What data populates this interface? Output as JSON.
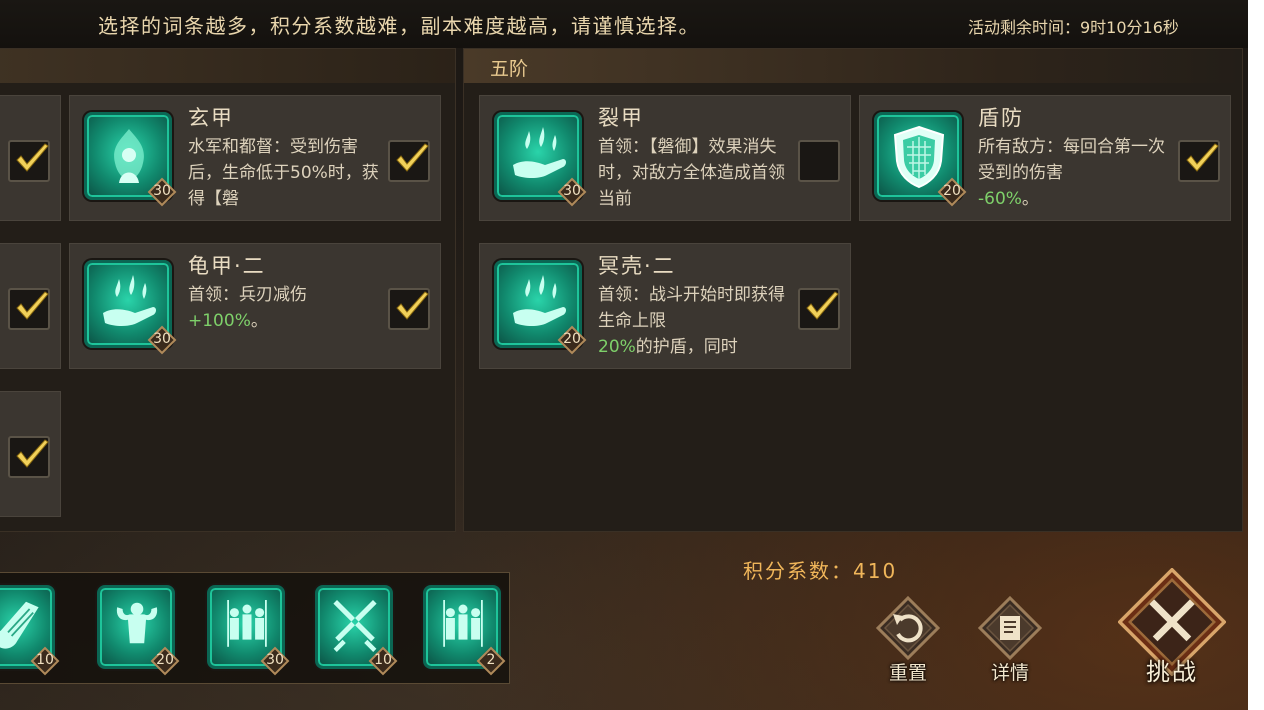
{
  "notice": "选择的词条越多，积分系数越难，副本难度越高，请谨慎选择。",
  "timer": "活动剩余时间：9时10分16秒",
  "right_panel": {
    "title": "五阶"
  },
  "cards": {
    "left_col1": [
      {
        "checked": true
      },
      {
        "checked": true
      },
      {
        "checked": true
      }
    ],
    "xuanjia": {
      "title": "玄甲",
      "desc": "水军和都督：受到伤害后，生命低于50%时，获得【磐",
      "icon": "flame-figure-icon",
      "level": "30",
      "checked": true
    },
    "guijia": {
      "title": "龟甲·二",
      "desc_prefix": "首领：兵刃减伤",
      "desc_green": "+100%",
      "desc_suffix": "。",
      "icon": "hand-drops-icon",
      "level": "30",
      "checked": true
    },
    "liejia": {
      "title": "裂甲",
      "desc": "首领：【磐御】效果消失时，对敌方全体造成首领当前",
      "icon": "hand-drops-icon",
      "level": "30",
      "checked": false
    },
    "dunfang": {
      "title": "盾防",
      "desc_prefix": "所有敌方：每回合第一次受到的伤害",
      "desc_green": "-60%",
      "desc_suffix": "。",
      "icon": "shield-icon",
      "level": "20",
      "checked": true
    },
    "mingke": {
      "title": "冥壳·二",
      "desc_prefix": "首领：战斗开始时即获得生命上限",
      "desc_green": "20%",
      "desc_suffix": "的护盾，同时",
      "icon": "hand-drops-icon",
      "level": "20",
      "checked": true
    }
  },
  "selected_icons": [
    {
      "icon": "armored-arm-icon",
      "level": "10"
    },
    {
      "icon": "strong-man-icon",
      "level": "20"
    },
    {
      "icon": "soldiers-icon",
      "level": "30"
    },
    {
      "icon": "crossed-swords-icon",
      "level": "10"
    },
    {
      "icon": "soldiers-icon",
      "level": "2"
    }
  ],
  "score": "积分系数：410",
  "buttons": {
    "reset": "重置",
    "details": "详情",
    "challenge": "挑战"
  },
  "colors": {
    "accent_gold": "#f0b65a",
    "icon_teal": "#1ec49a",
    "bonus_green": "#7ed06a"
  }
}
